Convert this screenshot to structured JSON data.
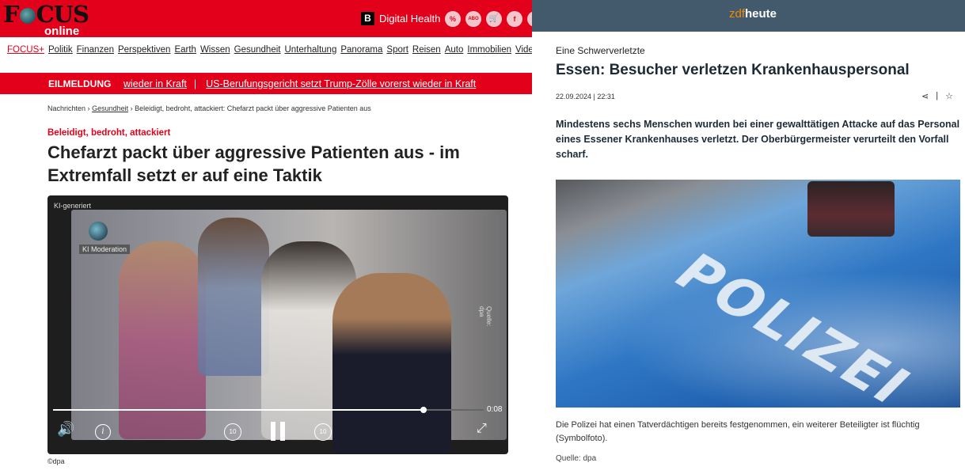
{
  "focus": {
    "logo": {
      "word_left": "F",
      "word_right": "CUS",
      "sub": "online"
    },
    "header": {
      "badge": "B",
      "label": "Digital Health",
      "icons": [
        {
          "name": "percent-icon",
          "glyph": "%"
        },
        {
          "name": "abo-icon",
          "glyph": "ABO"
        },
        {
          "name": "cart-icon",
          "glyph": "🛒"
        },
        {
          "name": "facebook-icon",
          "glyph": "f"
        },
        {
          "name": "more-icon",
          "glyph": "•"
        }
      ]
    },
    "nav": [
      "FOCUS+",
      "Politik",
      "Finanzen",
      "Perspektiven",
      "Earth",
      "Wissen",
      "Gesundheit",
      "Unterhaltung",
      "Panorama",
      "Sport",
      "Reisen",
      "Auto",
      "Immobilien",
      "Video"
    ],
    "breaking": {
      "label": "EILMELDUNG",
      "ticker_prev": "wieder in Kraft",
      "separator": "|",
      "ticker": "US-Berufungsgericht setzt Trump-Zölle vorerst wieder in Kraft"
    },
    "breadcrumb": [
      "Nachrichten",
      "Gesundheit",
      "Beleidigt, bedroht, attackiert: Chefarzt packt über aggressive Patienten aus"
    ],
    "breadcrumb_sep": "›",
    "kicker": "Beleidigt, bedroht, attackiert",
    "title": "Chefarzt packt über aggressive Patienten aus - im Extremfall setzt er auf eine Taktik",
    "video": {
      "ki_label": "KI-generiert",
      "ki_moderation": "KI Moderation",
      "source_vertical": "Quelle: dpa",
      "time": "0:08",
      "progress_fraction": 0.86,
      "seek_back": "10",
      "seek_fwd": "10"
    },
    "credit": "©dpa"
  },
  "zdf": {
    "logo": {
      "zdf": "zdf",
      "heute": "heute"
    },
    "kicker": "Eine Schwerverletzte",
    "title": "Essen: Besucher verletzen Krankenhauspersonal",
    "date": "22.09.2024 | 22:31",
    "actions": {
      "share": "⋖",
      "sep": "|",
      "star": "☆"
    },
    "lead": "Mindestens sechs Menschen wurden bei einer gewalttätigen Attacke auf das Personal eines Essener Krankenhauses verletzt. Der Oberbürgermeister verurteilt den Vorfall scharf.",
    "image_text": "POLIZEI",
    "caption": "Die Polizei hat einen Tatverdächtigen bereits festgenommen, ein weiterer Beteiligter ist flüchtig (Symbolfoto).",
    "source": "Quelle: dpa"
  },
  "colors": {
    "focus_red": "#e2001a",
    "zdf_bar": "#435a6d",
    "zdf_orange": "#f08c00"
  }
}
